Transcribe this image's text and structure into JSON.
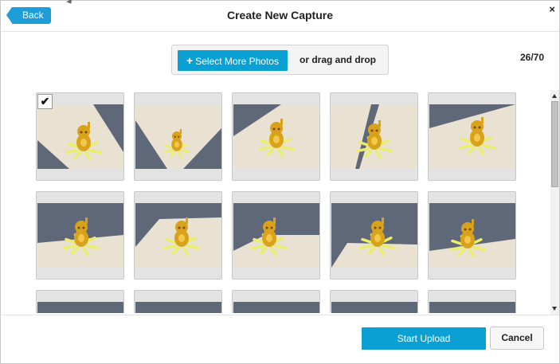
{
  "header": {
    "back_label": "Back",
    "title": "Create New Capture",
    "close_glyph": "×"
  },
  "upload_bar": {
    "select_plus": "+",
    "select_label": "Select More Photos",
    "drag_label": "or drag and drop"
  },
  "counter": "26/70",
  "thumbnails": [
    {
      "checked": true,
      "scene": "A"
    },
    {
      "checked": false,
      "scene": "B"
    },
    {
      "checked": false,
      "scene": "C"
    },
    {
      "checked": false,
      "scene": "D"
    },
    {
      "checked": false,
      "scene": "E"
    },
    {
      "checked": false,
      "scene": "F"
    },
    {
      "checked": false,
      "scene": "G"
    },
    {
      "checked": false,
      "scene": "H"
    },
    {
      "checked": false,
      "scene": "I"
    },
    {
      "checked": false,
      "scene": "J"
    },
    {
      "checked": false,
      "scene": "K"
    },
    {
      "checked": false,
      "scene": "L"
    },
    {
      "checked": false,
      "scene": "M"
    },
    {
      "checked": false,
      "scene": "N"
    },
    {
      "checked": false,
      "scene": "O"
    }
  ],
  "check_glyph": "✔",
  "footer": {
    "start_label": "Start Upload",
    "cancel_label": "Cancel"
  },
  "colors": {
    "accent": "#0aa0d4",
    "back_button": "#1e9ed8",
    "carpet": "#5f6878",
    "table": "#e9e1d2",
    "figurine": "#d8a21a",
    "tag": "#e9ef6a"
  },
  "icons": [
    "back-arrow-icon",
    "close-icon",
    "plus-icon",
    "checkmark-icon",
    "scroll-up-icon",
    "scroll-down-icon"
  ]
}
